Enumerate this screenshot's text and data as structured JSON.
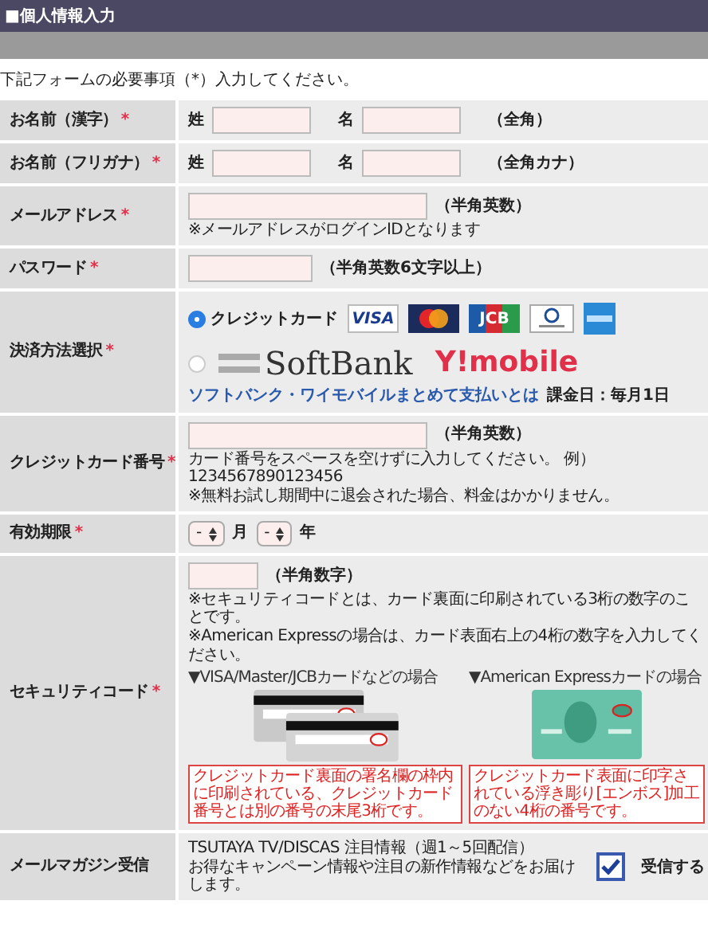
{
  "header": {
    "title": "■個人情報入力"
  },
  "intro": "下記フォームの必要事項（*）入力してください。",
  "rows": [
    {
      "kind": "name",
      "label": "お名前（漢字）",
      "mark": "*",
      "fields": [
        {
          "prefix": "姓"
        },
        {
          "prefix": "名"
        }
      ],
      "hint": "（全角）"
    },
    {
      "kind": "name",
      "label": "お名前（フリガナ）",
      "mark": "*",
      "fields": [
        {
          "prefix": "姓"
        },
        {
          "prefix": "名"
        }
      ],
      "hint": "（全角カナ）"
    },
    {
      "kind": "wide_input",
      "label": "メールアドレス",
      "mark": "*",
      "hint": "（半角英数）",
      "notes": [
        "※メールアドレスがログインIDとなります"
      ]
    },
    {
      "kind": "short_input",
      "label": "パスワード",
      "mark": "*",
      "hint": "（半角英数6文字以上）",
      "notes": []
    },
    {
      "kind": "payment",
      "label": "決済方法選択",
      "mark": "*",
      "options": [
        {
          "kind": "card",
          "label": "クレジットカード",
          "selected": true,
          "brands": [
            {
              "kind": "visa",
              "text": "VISA"
            },
            {
              "kind": "mastercard"
            },
            {
              "kind": "jcb",
              "text": "JCB"
            },
            {
              "kind": "diners"
            },
            {
              "kind": "amex"
            }
          ]
        },
        {
          "kind": "carrier",
          "selected": false,
          "brands": [
            {
              "kind": "softbank",
              "text": "SoftBank"
            },
            {
              "kind": "ymobile",
              "text": "Y!mobile"
            }
          ]
        }
      ],
      "link": "ソフトバンク・ワイモバイルまとめて支払いとは",
      "note": "課金日：毎月1日"
    },
    {
      "kind": "wide_input",
      "label": "クレジットカード番号",
      "mark": "*",
      "hint": "（半角英数）",
      "notes": [
        "カード番号をスペースを空けずに入力してください。 例）1234567890123456",
        "※無料お試し期間中に退会された場合、料金はかかりません。"
      ]
    },
    {
      "kind": "expiry",
      "label": "有効期限",
      "mark": "*",
      "selects": [
        {
          "value": "-",
          "unit": "月"
        },
        {
          "value": "-",
          "unit": "年"
        }
      ]
    },
    {
      "kind": "security",
      "label": "セキュリティコード",
      "mark": "*",
      "hint": "（半角数字）",
      "notes": [
        "※セキュリティコードとは、カード裏面に印刷されている3桁の数字のことです。",
        "※American Expressの場合は、カード表面右上の4桁の数字を入力してください。"
      ],
      "examples": [
        {
          "kind": "back",
          "caption": "▼VISA/Master/JCBカードなどの場合",
          "callout": "クレジットカード裏面の署名欄の枠内に印刷されている、クレジットカード番号とは別の番号の末尾3桁です。"
        },
        {
          "kind": "front",
          "caption": "▼American Expressカードの場合",
          "callout": "クレジットカード表面に印字されている浮き彫り[エンボス]加工のない4桁の番号です。"
        }
      ]
    },
    {
      "kind": "newsletter",
      "label": "メールマガジン受信",
      "title": "TSUTAYA TV/DISCAS 注目情報（週1～5回配信）",
      "text": "お得なキャンペーン情報や注目の新作情報などをお届けします。",
      "checkbox": {
        "label": "受信する",
        "checked": true
      }
    }
  ]
}
